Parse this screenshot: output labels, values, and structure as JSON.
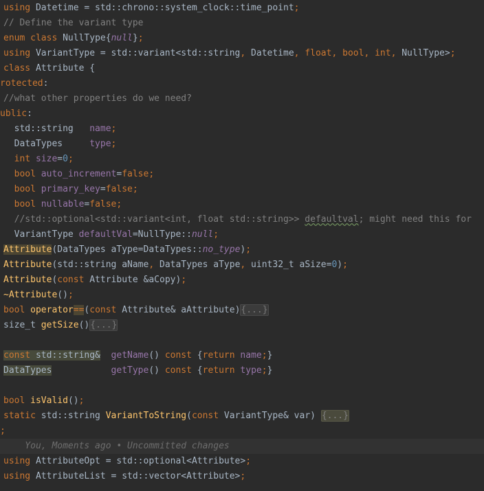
{
  "lines": [
    {
      "tokens": [
        [
          "kw",
          "using"
        ],
        [
          "tx",
          " Datetime = std::chrono::system_clock::time_point"
        ],
        [
          "kw",
          ";"
        ]
      ]
    },
    {
      "tokens": [
        [
          "cm",
          "// Define the variant type"
        ]
      ]
    },
    {
      "tokens": [
        [
          "kw",
          "enum class"
        ],
        [
          "tx",
          " NullType{"
        ],
        [
          "kwi",
          "null"
        ],
        [
          "tx",
          "}"
        ],
        [
          "kw",
          ";"
        ]
      ]
    },
    {
      "tokens": [
        [
          "kw",
          "using"
        ],
        [
          "tx",
          " VariantType = std::variant<std::string"
        ],
        [
          "kw",
          ","
        ],
        [
          "tx",
          " Datetime"
        ],
        [
          "kw",
          ","
        ],
        [
          "kw",
          " float"
        ],
        [
          "kw",
          ","
        ],
        [
          "kw",
          " bool"
        ],
        [
          "kw",
          ","
        ],
        [
          "kw",
          " int"
        ],
        [
          "kw",
          ","
        ],
        [
          "tx",
          " NullType>"
        ],
        [
          "kw",
          ";"
        ]
      ]
    },
    {
      "tokens": [
        [
          "kw",
          "class"
        ],
        [
          "tx",
          " Attribute {"
        ]
      ]
    },
    {
      "out": true,
      "tokens": [
        [
          "kw",
          "rotected"
        ],
        [
          "tx",
          ":"
        ]
      ]
    },
    {
      "tokens": [
        [
          "cm",
          "//what other properties do we need?"
        ]
      ]
    },
    {
      "out": true,
      "tokens": [
        [
          "kw",
          "ublic"
        ],
        [
          "tx",
          ":"
        ]
      ]
    },
    {
      "tokens": [
        [
          "tx",
          "  std::string   "
        ],
        [
          "mem",
          "name"
        ],
        [
          "kw",
          ";"
        ]
      ]
    },
    {
      "tokens": [
        [
          "tx",
          "  DataTypes     "
        ],
        [
          "mem",
          "type"
        ],
        [
          "kw",
          ";"
        ]
      ]
    },
    {
      "tokens": [
        [
          "kw",
          "  int"
        ],
        [
          "mem",
          " size"
        ],
        [
          "tx",
          "="
        ],
        [
          "num",
          "0"
        ],
        [
          "kw",
          ";"
        ]
      ]
    },
    {
      "tokens": [
        [
          "kw",
          "  bool"
        ],
        [
          "mem",
          " auto_increment"
        ],
        [
          "tx",
          "="
        ],
        [
          "kw",
          "false;"
        ]
      ]
    },
    {
      "tokens": [
        [
          "kw",
          "  bool"
        ],
        [
          "mem",
          " primary_key"
        ],
        [
          "tx",
          "="
        ],
        [
          "kw",
          "false;"
        ]
      ]
    },
    {
      "tokens": [
        [
          "kw",
          "  bool"
        ],
        [
          "mem",
          " nullable"
        ],
        [
          "tx",
          "="
        ],
        [
          "kw",
          "false;"
        ]
      ]
    },
    {
      "tokens": [
        [
          "cm",
          "  //std::optional<std::variant<int, float std::string>> "
        ],
        [
          "cmu",
          "defaultval"
        ],
        [
          "cm",
          "; might need this for"
        ]
      ]
    },
    {
      "tokens": [
        [
          "tx",
          "  VariantType "
        ],
        [
          "mem",
          "defaultVal"
        ],
        [
          "tx",
          "=NullType::"
        ],
        [
          "memi",
          "null"
        ],
        [
          "kw",
          ";"
        ]
      ]
    },
    {
      "tokens": [
        [
          "fnh",
          "Attribute"
        ],
        [
          "tx",
          "(DataTypes aType=DataTypes::"
        ],
        [
          "memi",
          "no_type"
        ],
        [
          "tx",
          ")"
        ],
        [
          "kw",
          ";"
        ]
      ]
    },
    {
      "tokens": [
        [
          "fn",
          "Attribute"
        ],
        [
          "tx",
          "(std::string aName"
        ],
        [
          "kw",
          ","
        ],
        [
          "tx",
          " DataTypes aType"
        ],
        [
          "kw",
          ","
        ],
        [
          "tx",
          " uint32_t aSize="
        ],
        [
          "num",
          "0"
        ],
        [
          "tx",
          ")"
        ],
        [
          "kw",
          ";"
        ]
      ]
    },
    {
      "tokens": [
        [
          "fn",
          "Attribute"
        ],
        [
          "tx",
          "("
        ],
        [
          "kw",
          "const"
        ],
        [
          "tx",
          " Attribute &aCopy)"
        ],
        [
          "kw",
          ";"
        ]
      ]
    },
    {
      "tokens": [
        [
          "fn",
          "~Attribute"
        ],
        [
          "tx",
          "()"
        ],
        [
          "kw",
          ";"
        ]
      ]
    },
    {
      "tokens": [
        [
          "kw",
          "bool"
        ],
        [
          "fn",
          " operator"
        ],
        [
          "kwh",
          "=="
        ],
        [
          "tx",
          "("
        ],
        [
          "kw",
          "const"
        ],
        [
          "tx",
          " Attribute& aAttribute)"
        ],
        [
          "fold",
          "{...}"
        ]
      ]
    },
    {
      "tokens": [
        [
          "tx",
          "size_t "
        ],
        [
          "fn",
          "getSize"
        ],
        [
          "tx",
          "()"
        ],
        [
          "fold",
          "{...}"
        ]
      ]
    },
    {
      "tokens": []
    },
    {
      "tokens": [
        [
          "kwh2",
          "const"
        ],
        [
          "tyh2",
          " std::string&"
        ],
        [
          "tx",
          "  "
        ],
        [
          "mem",
          "getName"
        ],
        [
          "tx",
          "() "
        ],
        [
          "kw",
          "const"
        ],
        [
          "tx",
          " {"
        ],
        [
          "kw",
          "return"
        ],
        [
          "mem",
          " name"
        ],
        [
          "kw",
          ";"
        ],
        [
          "tx",
          "}"
        ]
      ]
    },
    {
      "tokens": [
        [
          "tyh2",
          "DataTypes"
        ],
        [
          "tx",
          "           "
        ],
        [
          "mem",
          "getType"
        ],
        [
          "tx",
          "() "
        ],
        [
          "kw",
          "const"
        ],
        [
          "tx",
          " {"
        ],
        [
          "kw",
          "return"
        ],
        [
          "mem",
          " type"
        ],
        [
          "kw",
          ";"
        ],
        [
          "tx",
          "}"
        ]
      ]
    },
    {
      "tokens": []
    },
    {
      "tokens": [
        [
          "kw",
          "bool"
        ],
        [
          "fn",
          " isValid"
        ],
        [
          "tx",
          "()"
        ],
        [
          "kw",
          ";"
        ]
      ]
    },
    {
      "tokens": [
        [
          "kw",
          "static"
        ],
        [
          "tx",
          " std::string "
        ],
        [
          "fn",
          "VariantToString"
        ],
        [
          "tx",
          "("
        ],
        [
          "kw",
          "const"
        ],
        [
          "tx",
          " VariantType& var) "
        ],
        [
          "foldy",
          "{...}"
        ]
      ]
    },
    {
      "out": true,
      "tokens": [
        [
          "kw",
          ";"
        ]
      ]
    },
    {
      "blame": true,
      "tokens": [
        [
          "blame",
          "    You, Moments ago • Uncommitted changes"
        ]
      ]
    },
    {
      "tokens": [
        [
          "kw",
          "using"
        ],
        [
          "tx",
          " AttributeOpt = std::optional<Attribute>"
        ],
        [
          "kw",
          ";"
        ]
      ]
    },
    {
      "tokens": [
        [
          "kw",
          "using"
        ],
        [
          "tx",
          " AttributeList = std::vector<Attribute>"
        ],
        [
          "kw",
          ";"
        ]
      ]
    }
  ]
}
